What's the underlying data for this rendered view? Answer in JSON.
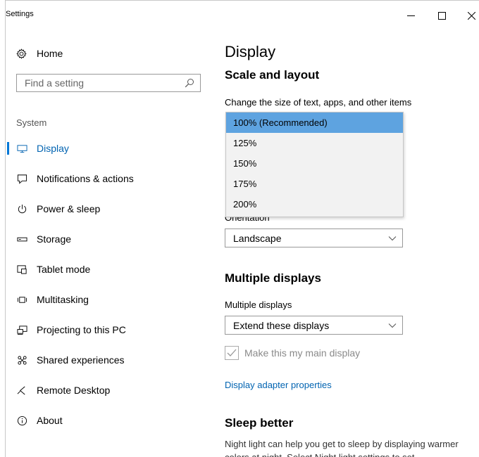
{
  "window": {
    "title": "Settings",
    "controls": {
      "minimize": "minimize-icon",
      "maximize": "maximize-icon",
      "close": "close-icon"
    }
  },
  "sidebar": {
    "home_label": "Home",
    "search_placeholder": "Find a setting",
    "section_label": "System",
    "items": [
      {
        "label": "Display",
        "icon": "monitor-icon",
        "active": true
      },
      {
        "label": "Notifications & actions",
        "icon": "notifications-icon"
      },
      {
        "label": "Power & sleep",
        "icon": "power-icon"
      },
      {
        "label": "Storage",
        "icon": "storage-icon"
      },
      {
        "label": "Tablet mode",
        "icon": "tablet-mode-icon"
      },
      {
        "label": "Multitasking",
        "icon": "multitasking-icon"
      },
      {
        "label": "Projecting to this PC",
        "icon": "projecting-icon"
      },
      {
        "label": "Shared experiences",
        "icon": "shared-experiences-icon"
      },
      {
        "label": "Remote Desktop",
        "icon": "remote-desktop-icon"
      },
      {
        "label": "About",
        "icon": "info-icon"
      }
    ]
  },
  "main": {
    "title": "Display",
    "scale_section": {
      "heading": "Scale and layout",
      "size_label": "Change the size of text, apps, and other items",
      "scale_options": [
        "100% (Recommended)",
        "125%",
        "150%",
        "175%",
        "200%"
      ],
      "selected_scale": "100% (Recommended)",
      "orientation_label": "Orientation",
      "orientation_value": "Landscape"
    },
    "multiple_section": {
      "heading": "Multiple displays",
      "label": "Multiple displays",
      "value": "Extend these displays",
      "main_display_label": "Make this my main display",
      "main_display_checked": true,
      "adapter_link": "Display adapter properties"
    },
    "sleep_section": {
      "heading": "Sleep better",
      "description": "Night light can help you get to sleep by displaying warmer colors at night. Select Night light settings to set"
    }
  },
  "colors": {
    "accent": "#0078d7",
    "link": "#0063b1",
    "dropdown_selected": "#5ea3e0"
  }
}
